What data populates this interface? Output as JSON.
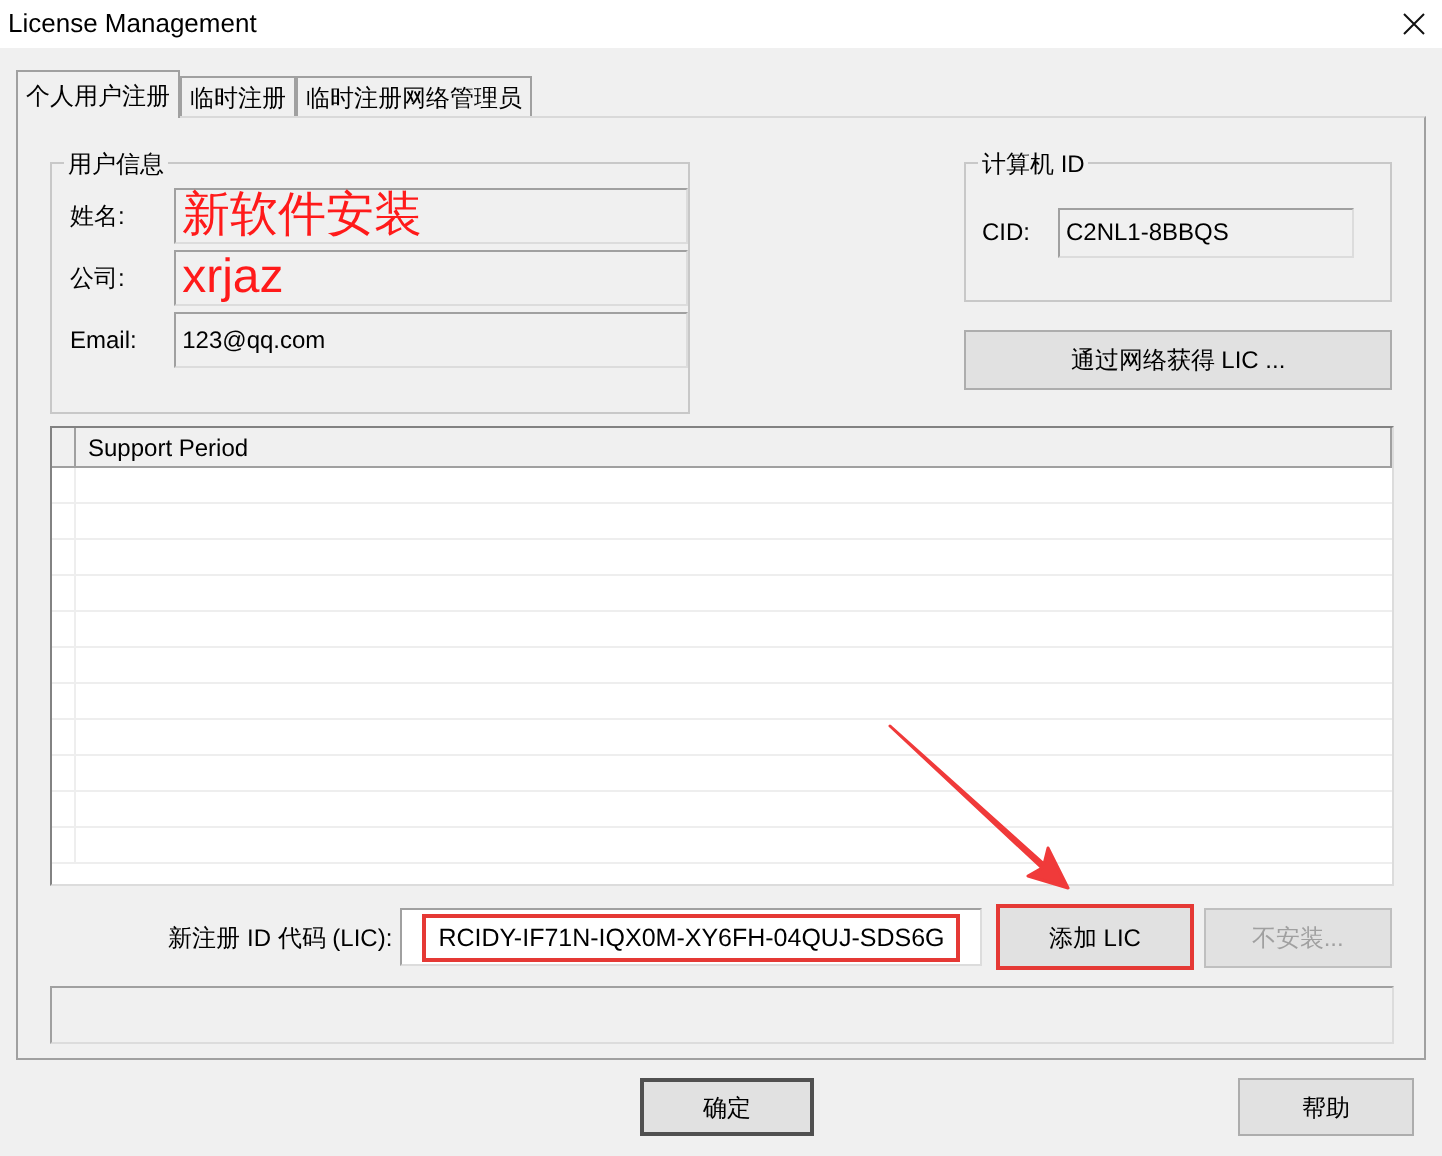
{
  "window": {
    "title": "License Management"
  },
  "tabs": [
    {
      "label": "个人用户注册",
      "selected": true
    },
    {
      "label": "临时注册",
      "selected": false
    },
    {
      "label": "临时注册网络管理员",
      "selected": false
    }
  ],
  "user_info": {
    "title": "用户信息",
    "fields": [
      {
        "label": "姓名:",
        "value": "新软件安装",
        "annotated": true
      },
      {
        "label": "公司:",
        "value": "xrjaz",
        "annotated": true
      },
      {
        "label": "Email:",
        "value": "123@qq.com",
        "annotated": false
      }
    ]
  },
  "computer_id": {
    "title": "计算机 ID",
    "label": "CID:",
    "value": "C2NL1-8BBQS"
  },
  "get_lic_button": {
    "label": "通过网络获得 LIC ..."
  },
  "table": {
    "columns": [
      "Support Period"
    ]
  },
  "license": {
    "label": "新注册 ID 代码 (LIC):",
    "value": "RCIDY-IF71N-IQX0M-XY6FH-04QUJ-SDS6G",
    "highlighted": true
  },
  "add_button": {
    "label": "添加 LIC",
    "highlighted": true,
    "disabled": false
  },
  "uninstall_button": {
    "label": "不安装...",
    "highlighted": false,
    "disabled": true
  },
  "footer_buttons": [
    {
      "label": "确定"
    },
    {
      "label": "帮助"
    }
  ]
}
